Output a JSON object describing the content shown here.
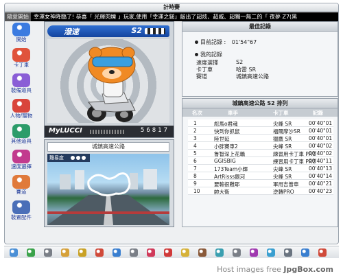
{
  "window": {
    "title": "計時賽"
  },
  "marquee": {
    "tag": "隨意開始",
    "text": "幸運女神降臨了! 恭喜「 光輝閃爍 」玩家,使用「幸運之鎚」敲出了超炫、超威、超獨一無二的「 夜夢 Z7(黑"
  },
  "sidebar": {
    "items": [
      {
        "label": "開始",
        "icon": "start-icon",
        "color": "#3b7be0"
      },
      {
        "label": "卡丁車",
        "icon": "kart-icon",
        "color": "#e0533b"
      },
      {
        "label": "裝備道具",
        "icon": "equipment-icon",
        "color": "#8a5ed6"
      },
      {
        "label": "人物/寵物",
        "icon": "character-icon",
        "color": "#d9453b"
      },
      {
        "label": "其他道具",
        "icon": "items-icon",
        "color": "#2c9c6a"
      },
      {
        "label": "速度選擇",
        "icon": "speed-icon",
        "color": "#c23b8e"
      },
      {
        "label": "賽道",
        "icon": "track-icon",
        "color": "#e07a3b"
      },
      {
        "label": "裝置配件",
        "icon": "accessory-icon",
        "color": "#4a6fb8"
      }
    ]
  },
  "character": {
    "banner_name": "潑速",
    "kart_class": "S2",
    "player_name": "MyLUCCI",
    "score": "56817"
  },
  "track": {
    "name": "城鎮高速公路",
    "difficulty_label": "難易度"
  },
  "info": {
    "heading": "最佳記錄",
    "best_label": "目前記錄 :",
    "best_time": "01'54\"67",
    "my_record_label": "我的記錄",
    "rows": [
      {
        "key": "速度選擇",
        "value": "S2"
      },
      {
        "key": "卡丁車",
        "value": "哈雷 SR"
      },
      {
        "key": "賽道",
        "value": "城鎮高速公路"
      }
    ]
  },
  "ranking": {
    "heading": "城鎮高速公路 S2 排列",
    "columns": [
      "名次",
      "車手",
      "卡丁車",
      "記錄"
    ],
    "rows": [
      {
        "rank": "1",
        "driver": "彪馬o君魂",
        "kart": "尖峰 SR",
        "time": "00'40\"01"
      },
      {
        "rank": "2",
        "driver": "快到你抓鼠",
        "kart": "福爾摩沙SR",
        "time": "00'40\"01"
      },
      {
        "rank": "3",
        "driver": "陸世延",
        "kart": "獵鷹 SR",
        "time": "00'40\"01"
      },
      {
        "rank": "4",
        "driver": "小胖賽車2",
        "kart": "尖峰 SR",
        "time": "00'40\"02"
      },
      {
        "rank": "5",
        "driver": "鲁智深上花轎",
        "kart": "練習用卡丁車 PRO",
        "time": "00'40\"02"
      },
      {
        "rank": "6",
        "driver": "GGISBIG",
        "kart": "練習用卡丁車 PRO",
        "time": "00'40\"11"
      },
      {
        "rank": "7",
        "driver": "173Team小輝",
        "kart": "尖峰 SR",
        "time": "00'40\"13"
      },
      {
        "rank": "8",
        "driver": "ArtRisss銀河",
        "kart": "尖峰 SR",
        "time": "00'40\"14"
      },
      {
        "rank": "9",
        "driver": "要輸很難耶",
        "kart": "軍用吉普車",
        "time": "00'40\"21"
      },
      {
        "rank": "10",
        "driver": "帥大衛",
        "kart": "逆轉PRO",
        "time": "00'40\"23"
      }
    ]
  },
  "toolbar": {
    "icons": [
      {
        "name": "home-icon",
        "color": "#4a8fd6"
      },
      {
        "name": "back-icon",
        "color": "#3aa24a"
      },
      {
        "name": "cart-icon",
        "color": "#7a7f87"
      },
      {
        "name": "gift-icon",
        "color": "#d6a13a"
      },
      {
        "name": "trophy-icon",
        "color": "#c9a227"
      },
      {
        "name": "mail-icon",
        "color": "#d04a3a"
      },
      {
        "name": "user-icon",
        "color": "#3a7fd0"
      },
      {
        "name": "clock-icon",
        "color": "#7a7f87"
      },
      {
        "name": "heart-icon",
        "color": "#d03a5a"
      },
      {
        "name": "alert-icon",
        "color": "#d03a3a"
      },
      {
        "name": "star-icon",
        "color": "#d6b23a"
      },
      {
        "name": "book-icon",
        "color": "#8a5a3a"
      },
      {
        "name": "photo-icon",
        "color": "#3a9fb0"
      },
      {
        "name": "note-icon",
        "color": "#7a7f87"
      },
      {
        "name": "music-icon",
        "color": "#a03ab0"
      },
      {
        "name": "chat-icon",
        "color": "#3a9fd0"
      },
      {
        "name": "settings-icon",
        "color": "#6a7480"
      },
      {
        "name": "help-icon",
        "color": "#3a7fd0"
      },
      {
        "name": "exit-icon",
        "color": "#d04a3a"
      }
    ]
  },
  "footer": {
    "prefix": "Host images free ",
    "brand": "JpgBox.com"
  }
}
